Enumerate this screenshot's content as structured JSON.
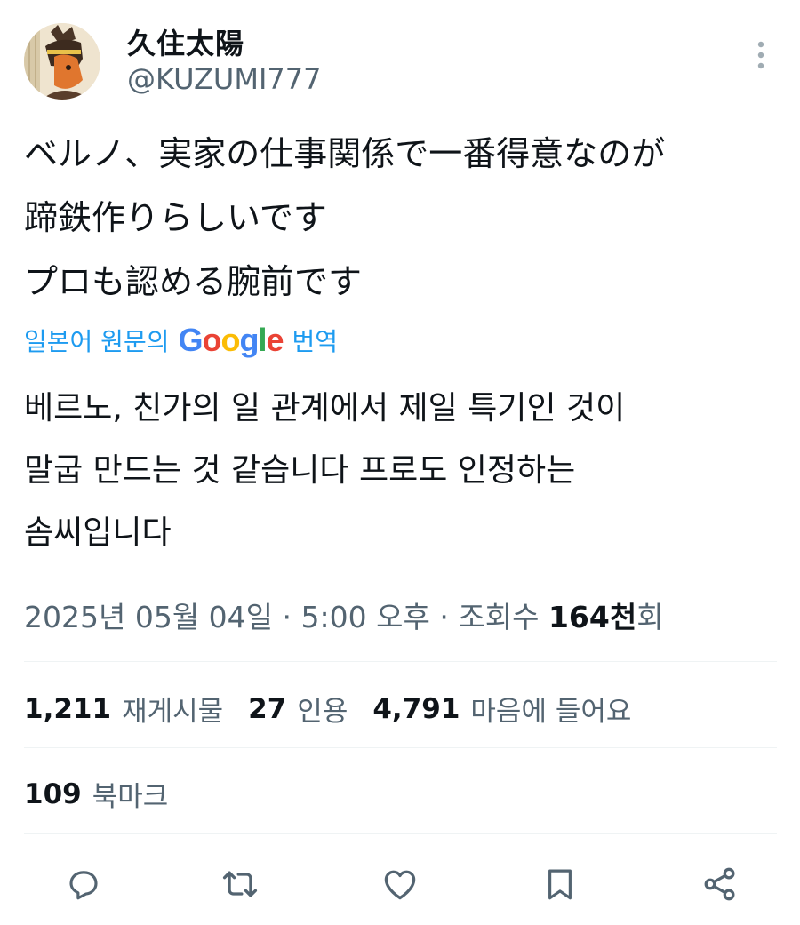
{
  "author": {
    "display_name": "久住太陽",
    "handle": "@KUZUMI777",
    "avatar_icon": "avatar-illustration"
  },
  "tweet": {
    "text": "ベルノ、実家の仕事関係で一番得意なのが\n蹄鉄作りらしいです\nプロも認める腕前です"
  },
  "translation": {
    "prefix": "일본어 원문의",
    "google": [
      "G",
      "o",
      "o",
      "g",
      "l",
      "e"
    ],
    "suffix": "번역",
    "text": "베르노, 친가의 일 관계에서 제일 특기인 것이\n말굽 만드는 것 같습니다 프로도 인정하는\n솜씨입니다"
  },
  "meta": {
    "date": "2025년 05월 04일",
    "separator": "·",
    "time": "5:00 오후",
    "views_label": "조회수",
    "views_count": "164천",
    "views_suffix": "회"
  },
  "stats": {
    "reposts": {
      "count": "1,211",
      "label": "재게시물"
    },
    "quotes": {
      "count": "27",
      "label": "인용"
    },
    "likes": {
      "count": "4,791",
      "label": "마음에 들어요"
    },
    "bookmarks": {
      "count": "109",
      "label": "북마크"
    }
  },
  "actions": [
    "reply-icon",
    "retweet-icon",
    "like-icon",
    "bookmark-icon",
    "share-icon"
  ],
  "colors": {
    "text": "#0f1419",
    "secondary": "#536471",
    "link": "#1d9bf0",
    "divider": "#eff3f4",
    "google_blue": "#4285F4",
    "google_red": "#EA4335",
    "google_yellow": "#FBBC05",
    "google_green": "#34A853"
  }
}
